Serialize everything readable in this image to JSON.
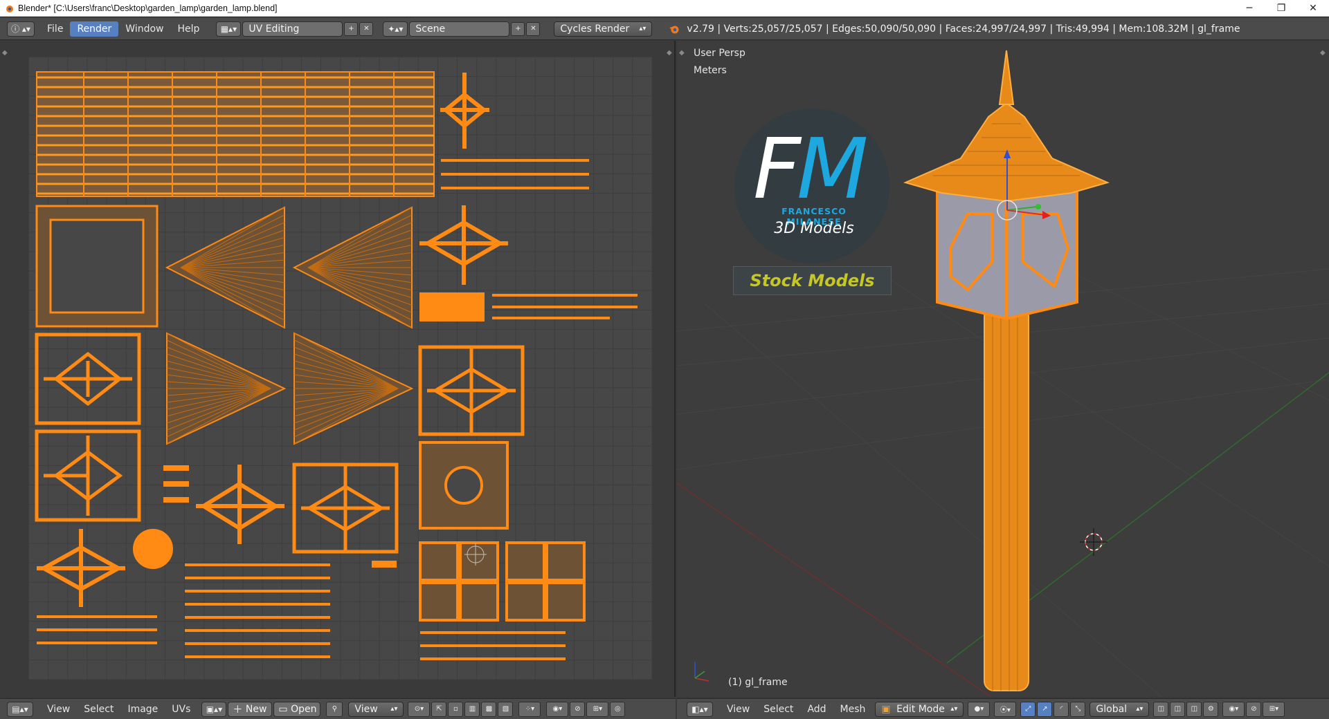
{
  "titlebar": {
    "title": "Blender* [C:\\Users\\franc\\Desktop\\garden_lamp\\garden_lamp.blend]",
    "minimize": "─",
    "maximize": "❐",
    "close": "✕"
  },
  "header": {
    "menus": [
      "File",
      "Render",
      "Window",
      "Help"
    ],
    "active_menu": "Render",
    "layout_value": "UV Editing",
    "scene_value": "Scene",
    "engine_value": "Cycles Render",
    "stats": "v2.79 | Verts:25,057/25,057 | Edges:50,090/50,090 | Faces:24,997/24,997 | Tris:49,994 | Mem:108.32M | gl_frame"
  },
  "uv_footer": {
    "menus": [
      "View",
      "Select",
      "Image",
      "UVs"
    ],
    "new_label": "New",
    "open_label": "Open",
    "view_label": "View"
  },
  "viewport": {
    "persp_label": "User Persp",
    "units_label": "Meters",
    "object_label": "(1) gl_frame"
  },
  "logo": {
    "f": "F",
    "m": "M",
    "name": "FRANCESCO MILANESE",
    "subtitle": "3D Models",
    "stock": "Stock Models"
  },
  "vp_footer": {
    "menus": [
      "View",
      "Select",
      "Add",
      "Mesh"
    ],
    "mode_value": "Edit Mode",
    "orientation_value": "Global"
  },
  "colors": {
    "uv_orange": "#ff8a14",
    "fill_brown": "#6e5236",
    "accent_blue": "#5680c2",
    "logo_blue": "#1ea8e0",
    "stock_yellow": "#c7c722"
  }
}
